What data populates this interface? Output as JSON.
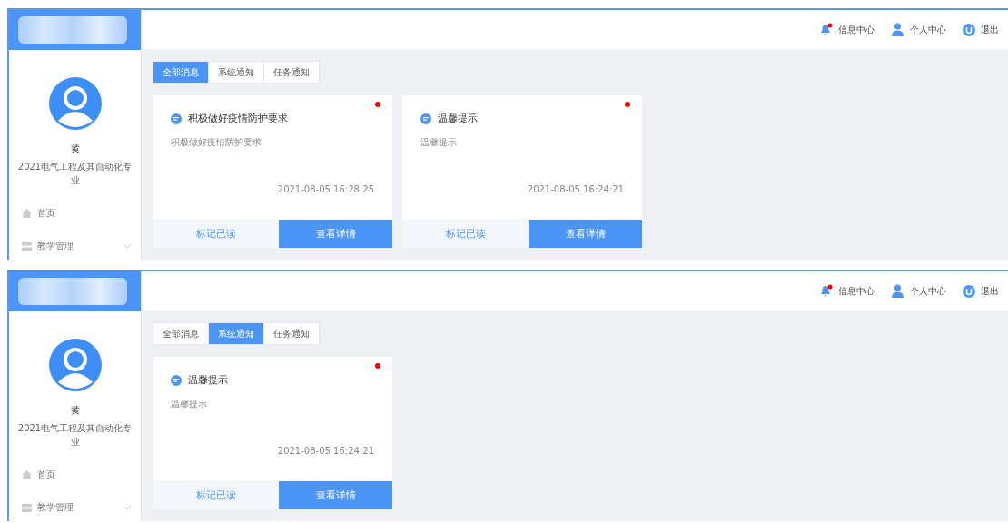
{
  "screens": [
    {
      "header": {
        "actions": [
          {
            "kind": "notifications",
            "label": "信息中心",
            "unread": true
          },
          {
            "kind": "profile",
            "label": "个人中心"
          },
          {
            "kind": "logout",
            "label": "退出"
          }
        ]
      },
      "sidebar": {
        "user": {
          "name": "黄",
          "major": "2021电气工程及其自动化专业"
        },
        "menu": [
          {
            "kind": "home",
            "label": "首页"
          },
          {
            "kind": "group",
            "label": "教学管理",
            "expanded": false
          }
        ]
      },
      "tabs": [
        {
          "label": "全部消息",
          "selected": true
        },
        {
          "label": "系统通知",
          "selected": false
        },
        {
          "label": "任务通知",
          "selected": false
        }
      ],
      "cards": [
        {
          "title": "积极做好疫情防护要求",
          "body": "积极做好疫情防护要求",
          "time": "2021-08-05 16:28:25",
          "unread": true,
          "mark_read": "标记已读",
          "details": "查看详情"
        },
        {
          "title": "温馨提示",
          "body": "温馨提示",
          "time": "2021-08-05 16:24:21",
          "unread": true,
          "mark_read": "标记已读",
          "details": "查看详情"
        }
      ]
    },
    {
      "header": {
        "actions": [
          {
            "kind": "notifications",
            "label": "信息中心",
            "unread": true
          },
          {
            "kind": "profile",
            "label": "个人中心"
          },
          {
            "kind": "logout",
            "label": "退出"
          }
        ]
      },
      "sidebar": {
        "user": {
          "name": "黄",
          "major": "2021电气工程及其自动化专业"
        },
        "menu": [
          {
            "kind": "home",
            "label": "首页"
          },
          {
            "kind": "group",
            "label": "教学管理",
            "expanded": false
          }
        ]
      },
      "tabs": [
        {
          "label": "全部消息",
          "selected": false
        },
        {
          "label": "系统通知",
          "selected": true
        },
        {
          "label": "任务通知",
          "selected": false
        }
      ],
      "cards": [
        {
          "title": "温馨提示",
          "body": "温馨提示",
          "time": "2021-08-05 16:24:21",
          "unread": true,
          "mark_read": "标记已读",
          "details": "查看详情"
        }
      ]
    }
  ]
}
